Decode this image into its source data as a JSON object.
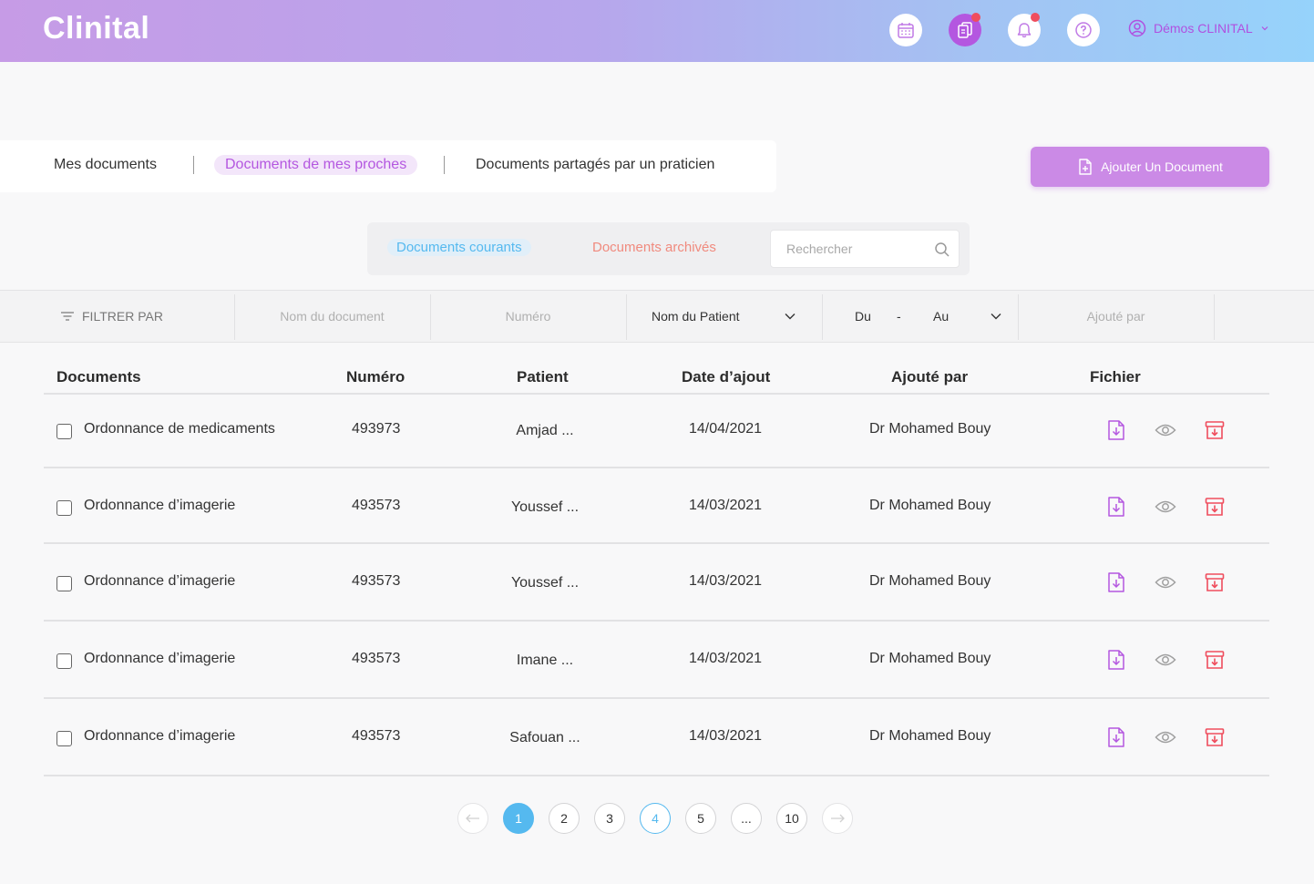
{
  "header": {
    "logo": "Clinital",
    "user_name": "Démos CLINITAL",
    "icons": [
      "calendar-icon",
      "documents-icon",
      "bell-icon",
      "help-icon"
    ]
  },
  "doc_tabs": {
    "mine": "Mes documents",
    "relatives": "Documents de mes proches",
    "shared": "Documents partagés par un praticien"
  },
  "add_button": "Ajouter Un Document",
  "sub_tabs": {
    "current": "Documents courants",
    "archived": "Documents archivés",
    "search_placeholder": "Rechercher"
  },
  "filters": {
    "label": "FILTRER PAR",
    "doc_name": "Nom du document",
    "number": "Numéro",
    "patient": "Nom du Patient",
    "from": "Du",
    "dash": "-",
    "to": "Au",
    "added_by": "Ajouté par"
  },
  "table": {
    "headers": {
      "documents": "Documents",
      "number": "Numéro",
      "patient": "Patient",
      "date": "Date d’ajout",
      "added_by": "Ajouté par",
      "file": "Fichier"
    },
    "rows": [
      {
        "name": "Ordonnance de medicaments",
        "number": "493973",
        "patient": "Amjad ...",
        "date": "14/04/2021",
        "added_by": "Dr Mohamed Bouy"
      },
      {
        "name": "Ordonnance d’imagerie",
        "number": "493573",
        "patient": "Youssef  ...",
        "date": "14/03/2021",
        "added_by": "Dr Mohamed Bouy"
      },
      {
        "name": "Ordonnance d’imagerie",
        "number": "493573",
        "patient": "Youssef ...",
        "date": "14/03/2021",
        "added_by": "Dr Mohamed Bouy"
      },
      {
        "name": "Ordonnance d’imagerie",
        "number": "493573",
        "patient": "Imane  ...",
        "date": "14/03/2021",
        "added_by": "Dr Mohamed Bouy"
      },
      {
        "name": "Ordonnance d’imagerie",
        "number": "493573",
        "patient": "Safouan  ...",
        "date": "14/03/2021",
        "added_by": "Dr Mohamed Bouy"
      }
    ]
  },
  "pagination": {
    "pages": [
      "1",
      "2",
      "3",
      "4",
      "5",
      "...",
      "10"
    ],
    "current": "1"
  },
  "colors": {
    "accent": "#b457e0",
    "blue": "#55b9ef",
    "archive": "#f08a7e",
    "delete": "#ef4d5d"
  }
}
